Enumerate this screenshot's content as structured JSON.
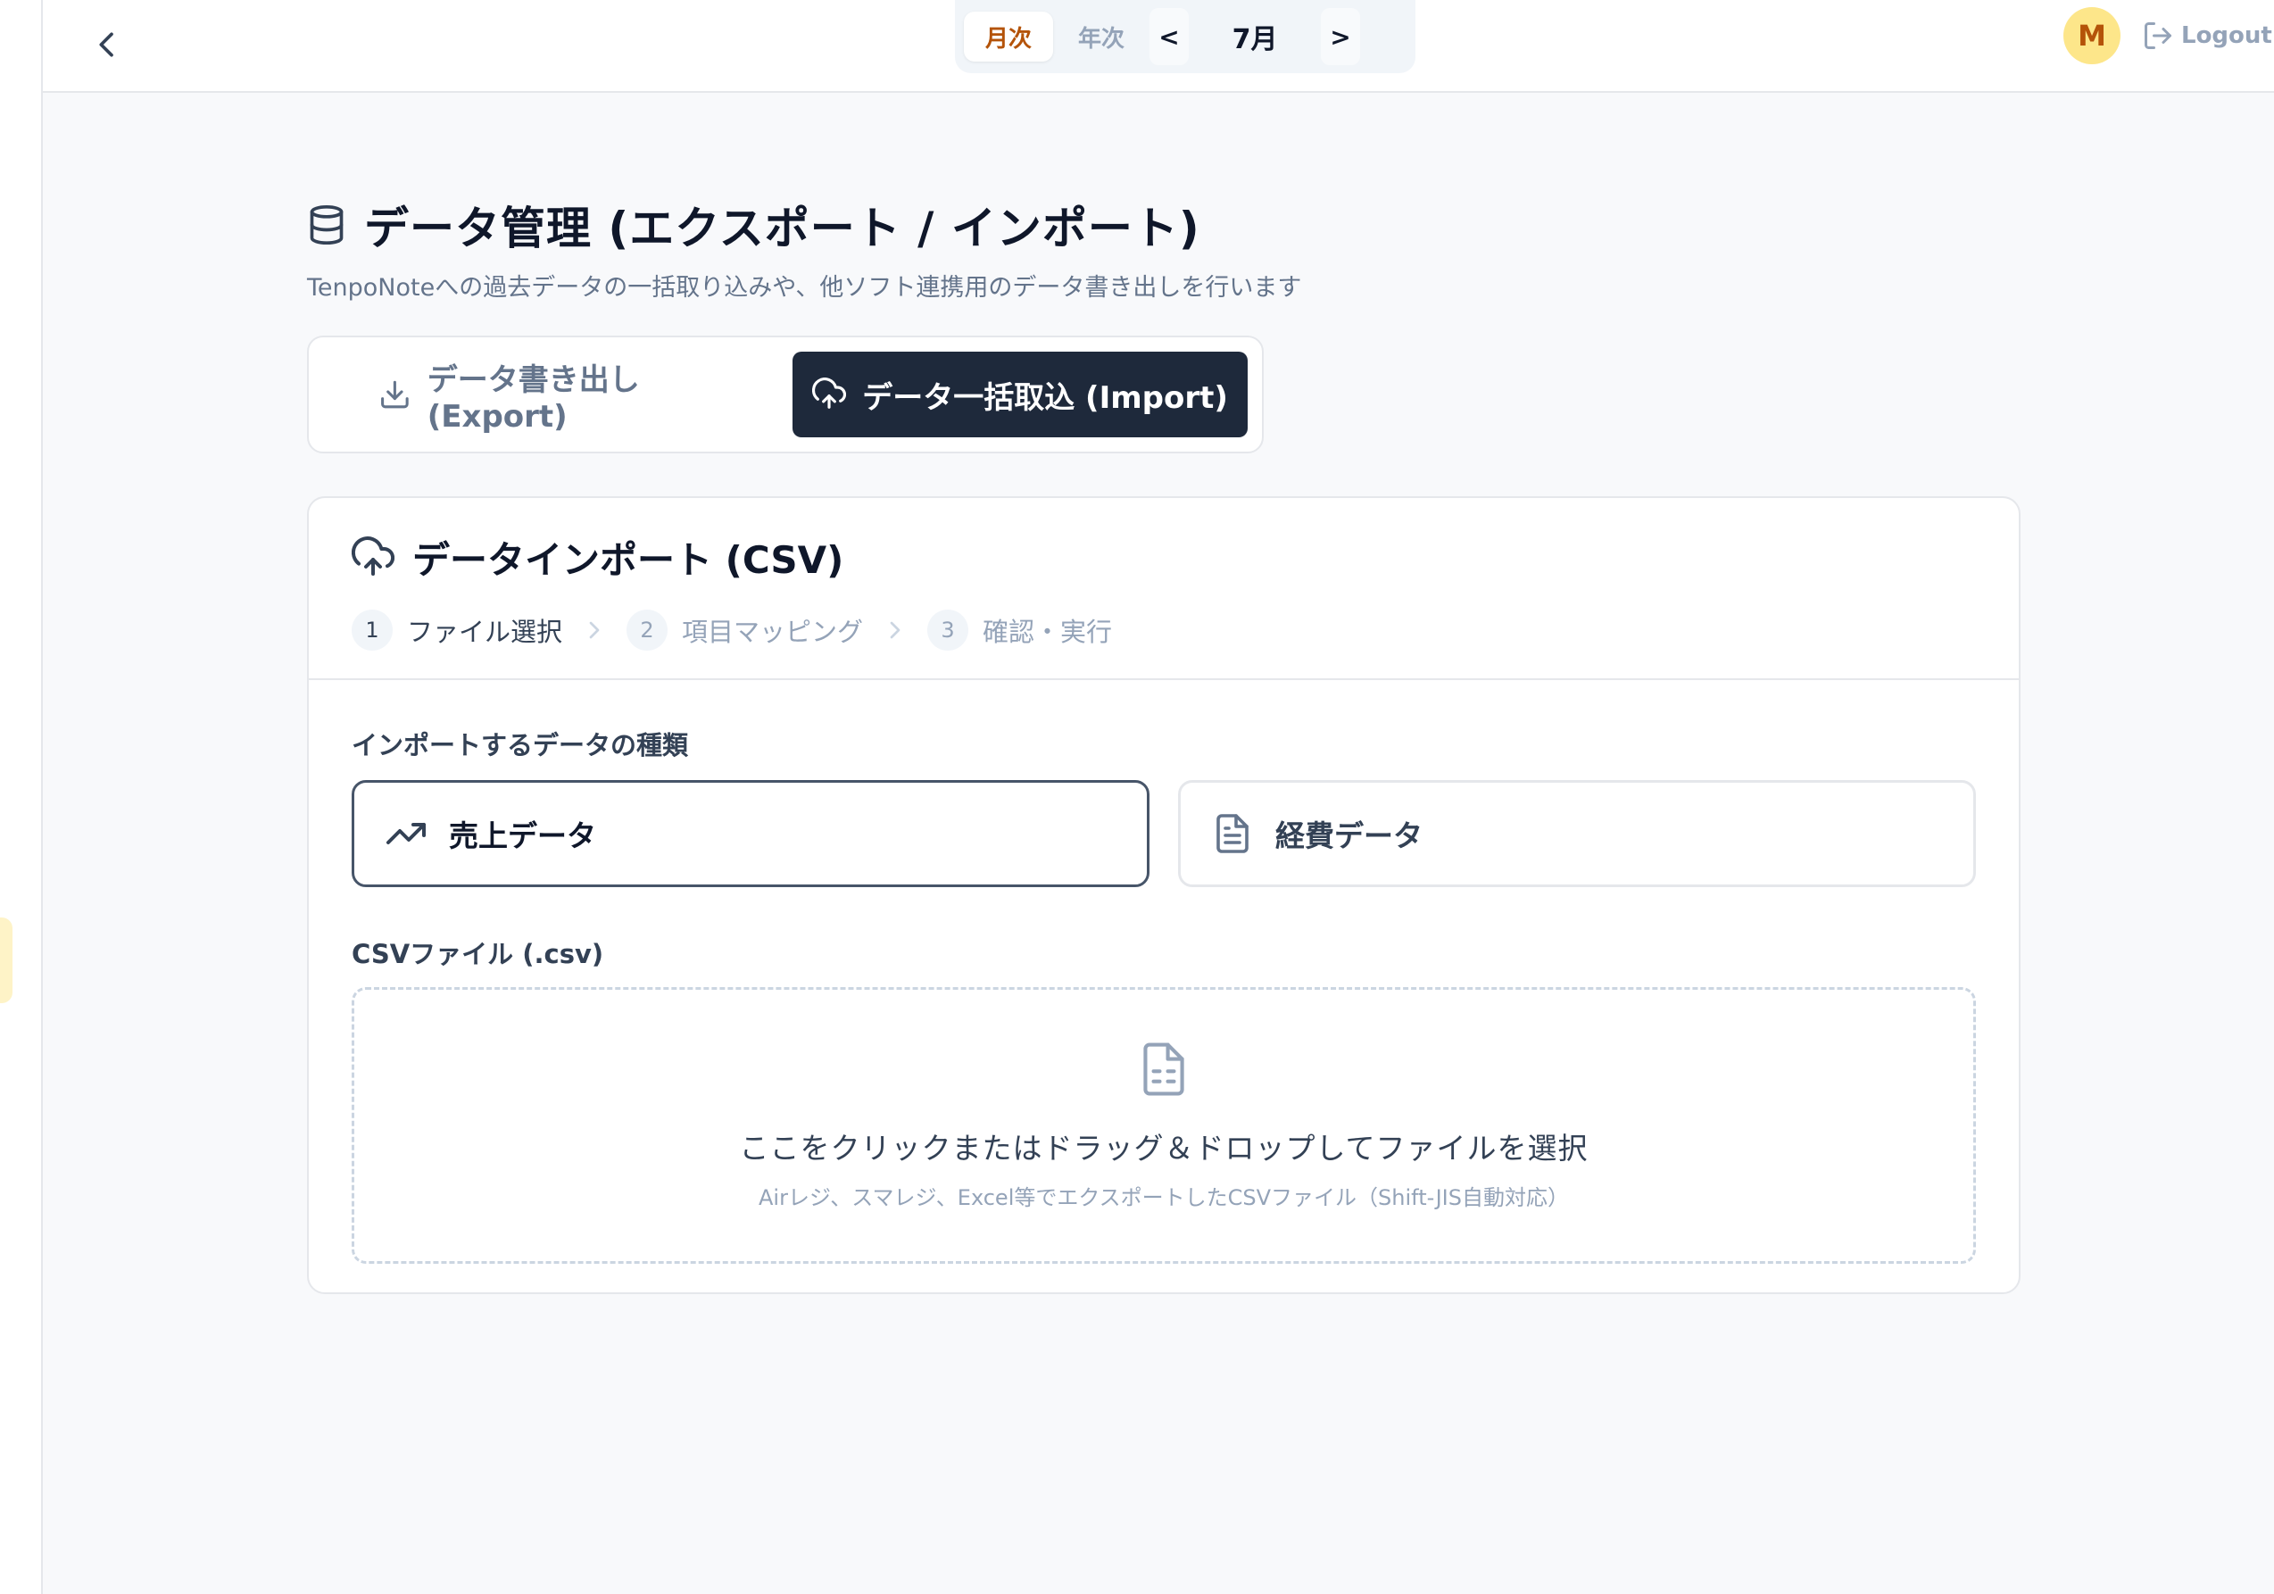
{
  "header": {
    "period_monthly": "月次",
    "period_yearly": "年次",
    "prev": "<",
    "next": ">",
    "month": "7月",
    "avatar_initial": "M",
    "logout": "Logout"
  },
  "page": {
    "title": "データ管理 (エクスポート / インポート)",
    "subtitle": "TenpoNoteへの過去データの一括取り込みや、他ソフト連携用のデータ書き出しを行います"
  },
  "tabs": {
    "export": "データ書き出し (Export)",
    "import": "データ一括取込 (Import)"
  },
  "import_card": {
    "title": "データインポート (CSV)",
    "steps": [
      {
        "num": "1",
        "label": "ファイル選択"
      },
      {
        "num": "2",
        "label": "項目マッピング"
      },
      {
        "num": "3",
        "label": "確認・実行"
      }
    ],
    "type_label": "インポートするデータの種類",
    "types": {
      "sales": "売上データ",
      "expense": "経費データ"
    },
    "file_label": "CSVファイル (.csv)",
    "dropzone_main": "ここをクリックまたはドラッグ＆ドロップしてファイルを選択",
    "dropzone_sub": "Airレジ、スマレジ、Excel等でエクスポートしたCSVファイル（Shift-JIS自動対応）"
  },
  "colors": {
    "accent": "#b45309",
    "dark": "#1e293b",
    "avatar_bg": "#fde68a"
  },
  "icons": [
    "chevron-left-icon",
    "logout-icon",
    "database-icon",
    "download-icon",
    "cloud-upload-icon",
    "chevron-right-icon",
    "trending-up-icon",
    "file-text-icon",
    "file-spreadsheet-icon"
  ]
}
